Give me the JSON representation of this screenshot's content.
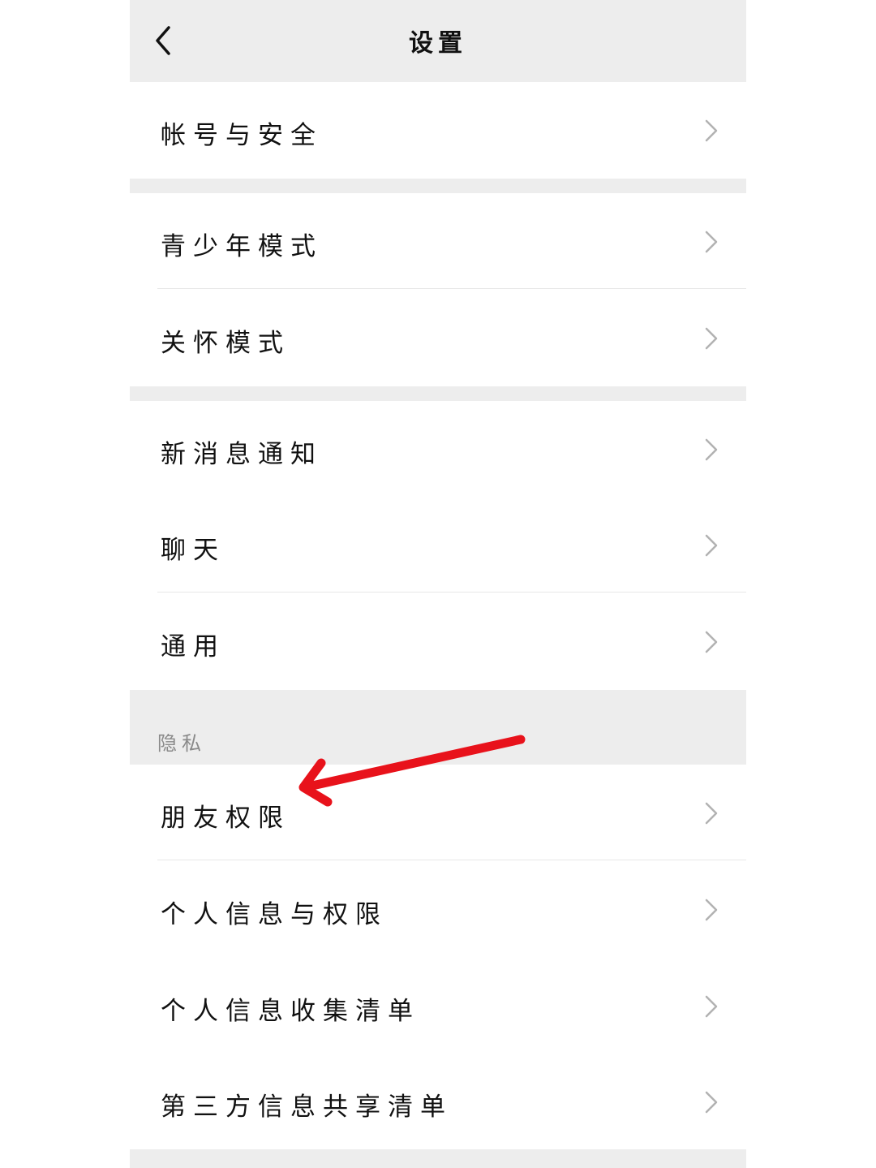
{
  "header": {
    "title": "设置"
  },
  "groups": [
    {
      "items": [
        {
          "label": "帐号与安全"
        }
      ]
    },
    {
      "items": [
        {
          "label": "青少年模式"
        },
        {
          "label": "关怀模式"
        }
      ]
    },
    {
      "items": [
        {
          "label": "新消息通知"
        },
        {
          "label": "聊天"
        },
        {
          "label": "通用"
        }
      ]
    },
    {
      "section_title": "隐私",
      "items": [
        {
          "label": "朋友权限"
        },
        {
          "label": "个人信息与权限"
        },
        {
          "label": "个人信息收集清单"
        },
        {
          "label": "第三方信息共享清单"
        }
      ]
    }
  ],
  "annotation": {
    "arrow_color": "#e8121b"
  },
  "colors": {
    "header_bg": "#ededed",
    "separator_bg": "#ededed",
    "text": "#111111",
    "chevron": "#b2b2b2"
  }
}
